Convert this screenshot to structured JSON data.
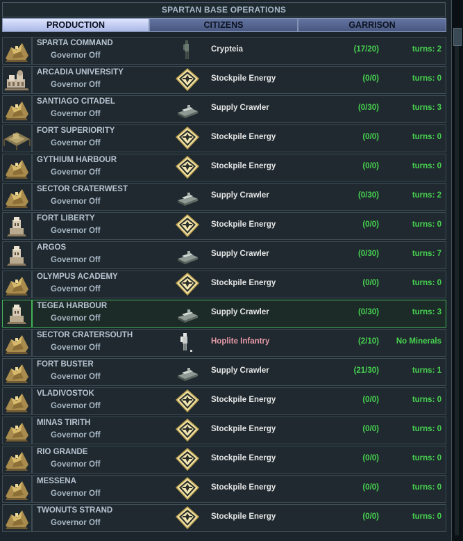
{
  "window": {
    "title": "SPARTAN BASE OPERATIONS"
  },
  "tabs": [
    {
      "label": "PRODUCTION",
      "active": true
    },
    {
      "label": "CITIZENS",
      "active": false
    },
    {
      "label": "GARRISON",
      "active": false
    }
  ],
  "colors": {
    "progress": "#48d250",
    "warning_item": "#e79aa8",
    "selected_border": "#45b45a"
  },
  "bases": [
    {
      "name": "SPARTA COMMAND",
      "governor": "Governor Off",
      "icon": "base-fortress-icon",
      "unit_icon": "crypteia-soldier-icon",
      "item": "Crypteia",
      "progress": "(17/20)",
      "status": "turns:  2"
    },
    {
      "name": "ARCADIA UNIVERSITY",
      "governor": "Governor Off",
      "icon": "base-university-icon",
      "unit_icon": "stockpile-energy-icon",
      "item": "Stockpile Energy",
      "progress": "(0/0)",
      "status": "turns:  0"
    },
    {
      "name": "SANTIAGO CITADEL",
      "governor": "Governor Off",
      "icon": "base-fortress-icon",
      "unit_icon": "supply-crawler-icon",
      "item": "Supply Crawler",
      "progress": "(0/30)",
      "status": "turns:  3"
    },
    {
      "name": "FORT SUPERIORITY",
      "governor": "Governor Off",
      "icon": "base-sea-platform-icon",
      "unit_icon": "stockpile-energy-icon",
      "item": "Stockpile Energy",
      "progress": "(0/0)",
      "status": "turns:  0"
    },
    {
      "name": "GYTHIUM HARBOUR",
      "governor": "Governor Off",
      "icon": "base-fortress-icon",
      "unit_icon": "stockpile-energy-icon",
      "item": "Stockpile Energy",
      "progress": "(0/0)",
      "status": "turns:  0"
    },
    {
      "name": "SECTOR CRATERWEST",
      "governor": "Governor Off",
      "icon": "base-fortress-icon",
      "unit_icon": "supply-crawler-icon",
      "item": "Supply Crawler",
      "progress": "(0/30)",
      "status": "turns:  2"
    },
    {
      "name": "FORT LIBERTY",
      "governor": "Governor Off",
      "icon": "base-outpost-icon",
      "unit_icon": "stockpile-energy-icon",
      "item": "Stockpile Energy",
      "progress": "(0/0)",
      "status": "turns:  0"
    },
    {
      "name": "ARGOS",
      "governor": "Governor Off",
      "icon": "base-outpost-icon",
      "unit_icon": "supply-crawler-icon",
      "item": "Supply Crawler",
      "progress": "(0/30)",
      "status": "turns:  7"
    },
    {
      "name": "OLYMPUS ACADEMY",
      "governor": "Governor Off",
      "icon": "base-fortress-icon",
      "unit_icon": "stockpile-energy-icon",
      "item": "Stockpile Energy",
      "progress": "(0/0)",
      "status": "turns:  0"
    },
    {
      "name": "TEGEA HARBOUR",
      "governor": "Governor Off",
      "icon": "base-outpost-icon",
      "unit_icon": "supply-crawler-icon",
      "item": "Supply Crawler",
      "progress": "(0/30)",
      "status": "turns:  3",
      "selected": true
    },
    {
      "name": "SECTOR CRATERSOUTH",
      "governor": "Governor Off",
      "icon": "base-fortress-icon",
      "unit_icon": "hoplite-infantry-icon",
      "item": "Hoplite Infantry",
      "progress": "(2/10)",
      "status": "No Minerals",
      "warning": true
    },
    {
      "name": "FORT BUSTER",
      "governor": "Governor Off",
      "icon": "base-fortress-icon",
      "unit_icon": "supply-crawler-icon",
      "item": "Supply Crawler",
      "progress": "(21/30)",
      "status": "turns:  1"
    },
    {
      "name": "VLADIVOSTOK",
      "governor": "Governor Off",
      "icon": "base-fortress-icon",
      "unit_icon": "stockpile-energy-icon",
      "item": "Stockpile Energy",
      "progress": "(0/0)",
      "status": "turns:  0"
    },
    {
      "name": "MINAS TIRITH",
      "governor": "Governor Off",
      "icon": "base-fortress-icon",
      "unit_icon": "stockpile-energy-icon",
      "item": "Stockpile Energy",
      "progress": "(0/0)",
      "status": "turns:  0"
    },
    {
      "name": "RIO GRANDE",
      "governor": "Governor Off",
      "icon": "base-fortress-icon",
      "unit_icon": "stockpile-energy-icon",
      "item": "Stockpile Energy",
      "progress": "(0/0)",
      "status": "turns:  0"
    },
    {
      "name": "MESSENA",
      "governor": "Governor Off",
      "icon": "base-fortress-icon",
      "unit_icon": "stockpile-energy-icon",
      "item": "Stockpile Energy",
      "progress": "(0/0)",
      "status": "turns:  0"
    },
    {
      "name": "TWONUTS STRAND",
      "governor": "Governor Off",
      "icon": "base-fortress-icon",
      "unit_icon": "stockpile-energy-icon",
      "item": "Stockpile Energy",
      "progress": "(0/0)",
      "status": "turns:  0"
    }
  ]
}
